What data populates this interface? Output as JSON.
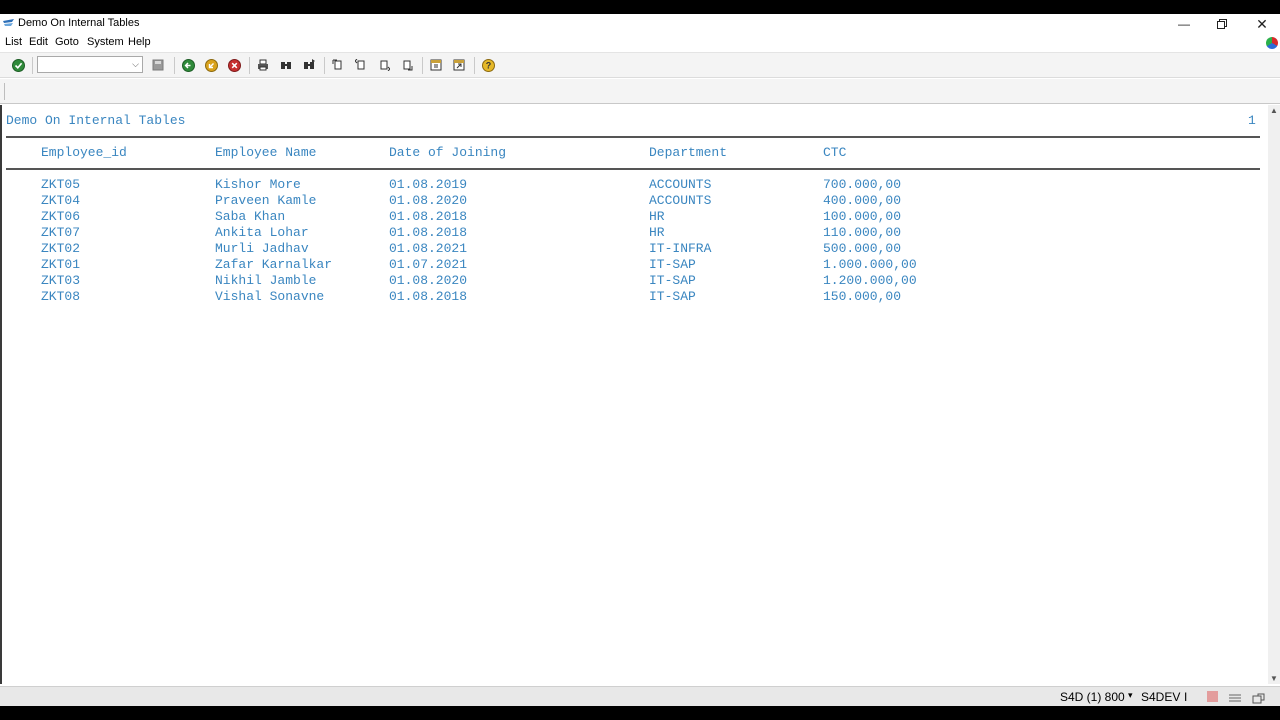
{
  "window": {
    "title": "Demo On Internal Tables"
  },
  "menu": [
    "List",
    "Edit",
    "Goto",
    "System",
    "Help"
  ],
  "toolbar": {
    "command_field_value": "",
    "icons": [
      "enter-icon",
      "save-icon",
      "back-icon",
      "exit-icon",
      "cancel-icon",
      "print-icon",
      "find-icon",
      "find-next-icon",
      "first-page-icon",
      "previous-page-icon",
      "next-page-icon",
      "last-page-icon",
      "new-session-icon",
      "shortcut-icon",
      "help-icon"
    ]
  },
  "report": {
    "title": "Demo On Internal Tables",
    "page_number": "1",
    "columns": [
      "Employee_id",
      "Employee Name",
      "Date of Joining",
      "Department",
      "CTC"
    ],
    "rows": [
      [
        "ZKT05",
        "Kishor More",
        "01.08.2019",
        "ACCOUNTS",
        "700.000,00"
      ],
      [
        "ZKT04",
        "Praveen Kamle",
        "01.08.2020",
        "ACCOUNTS",
        "400.000,00"
      ],
      [
        "ZKT06",
        "Saba Khan",
        "01.08.2018",
        "HR",
        "100.000,00"
      ],
      [
        "ZKT07",
        "Ankita Lohar",
        "01.08.2018",
        "HR",
        "110.000,00"
      ],
      [
        "ZKT02",
        "Murli Jadhav",
        "01.08.2021",
        "IT-INFRA",
        "500.000,00"
      ],
      [
        "ZKT01",
        "Zafar Karnalkar",
        "01.07.2021",
        "IT-SAP",
        "1.000.000,00"
      ],
      [
        "ZKT03",
        "Nikhil Jamble",
        "01.08.2020",
        "IT-SAP",
        "1.200.000,00"
      ],
      [
        "ZKT08",
        "Vishal Sonavne",
        "01.08.2018",
        "IT-SAP",
        "150.000,00"
      ]
    ]
  },
  "status": {
    "system": "S4D (1) 800",
    "server": "S4DEV",
    "mode": "I"
  },
  "colors": {
    "list_text": "#3a86c0",
    "status_bg": "#e8e8e8"
  }
}
